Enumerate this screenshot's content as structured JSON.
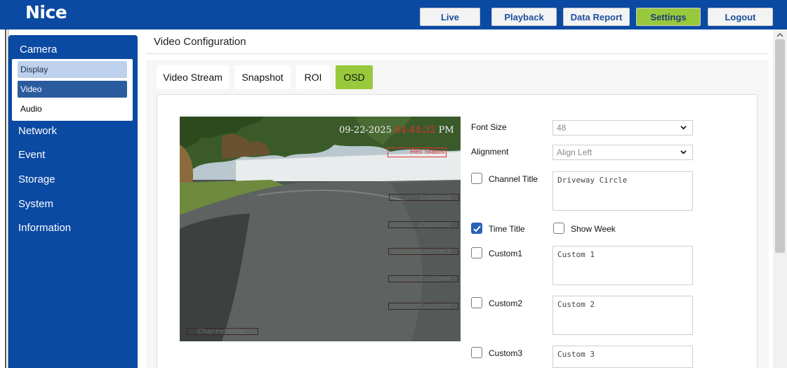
{
  "app": {
    "brand": "Nice"
  },
  "nav": {
    "live": "Live",
    "playback": "Playback",
    "data_report": "Data Report",
    "settings": "Settings",
    "logout": "Logout"
  },
  "sidebar": {
    "camera": "Camera",
    "sub": {
      "display": "Display",
      "video": "Video",
      "audio": "Audio"
    },
    "network": "Network",
    "event": "Event",
    "storage": "Storage",
    "system": "System",
    "information": "Information"
  },
  "page": {
    "title": "Video Configuration"
  },
  "tabs": {
    "video_stream": "Video Stream",
    "snapshot": "Snapshot",
    "roi": "ROI",
    "osd": "OSD"
  },
  "preview": {
    "timestamp_date": "09-22-2025",
    "timestamp_time": "04:44:32",
    "timestamp_ampm": "PM",
    "overlay_rec": "Rec Status",
    "overlays": {
      "custom1": "Custom1",
      "custom2": "Custom2",
      "custom3": "Custom3",
      "custom4": "Custom4",
      "custom5": "Custom5",
      "channel_title": "Channel Title"
    }
  },
  "form": {
    "font_size": {
      "label": "Font Size",
      "value": "48"
    },
    "alignment": {
      "label": "Alignment",
      "value": "Align Left"
    },
    "channel_title": {
      "label": "Channel Title",
      "value": "Driveway Circle",
      "checked": false
    },
    "time_title": {
      "label": "Time Title",
      "checked": true
    },
    "show_week": {
      "label": "Show Week",
      "checked": false
    },
    "custom1": {
      "label": "Custom1",
      "value": "Custom 1",
      "checked": false
    },
    "custom2": {
      "label": "Custom2",
      "value": "Custom 2",
      "checked": false
    },
    "custom3": {
      "label": "Custom3",
      "value": "Custom 3",
      "checked": false
    }
  },
  "colors": {
    "brand_blue": "#0b4aa3",
    "accent_green": "#98c93c",
    "checkbox_blue": "#2a63b7"
  }
}
